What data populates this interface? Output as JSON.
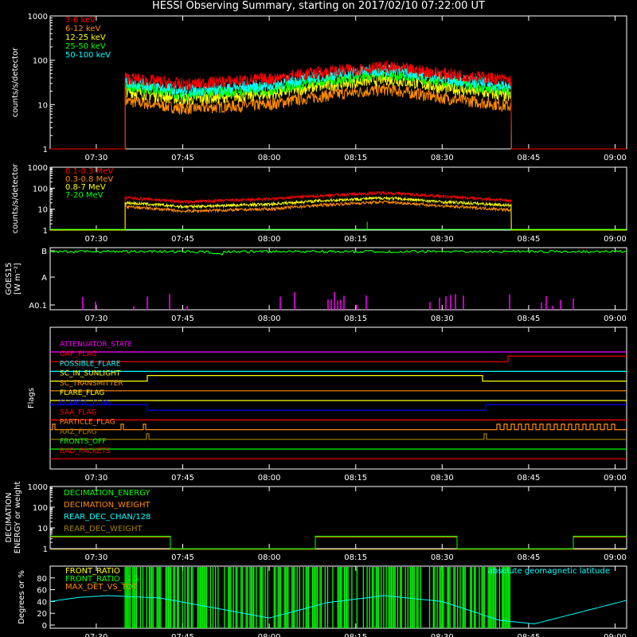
{
  "title": "HESSI Observing Summary, starting on 2017/02/10 07:22:00 UT",
  "colors": {
    "background": "#000000",
    "axes": "#ffffff",
    "red": "#ff0000",
    "orange": "#ff8c00",
    "yellow": "#ffff00",
    "green": "#00ff00",
    "cyan": "#00ffff",
    "magenta": "#ff00ff",
    "blue": "#0000ff",
    "brown": "#a08000"
  },
  "time_ticks": [
    "07:30",
    "07:45",
    "08:00",
    "08:15",
    "08:30",
    "08:45",
    "09:00"
  ],
  "chart_data": [
    {
      "type": "line",
      "panel": "hxr",
      "ylabel": "counts/s/detector",
      "yscale": "log",
      "ylim": [
        1,
        1000
      ],
      "yticks": [
        "1",
        "10",
        "100",
        "1000"
      ],
      "xlim": [
        "07:22",
        "09:02"
      ],
      "data_window": [
        "07:35",
        "08:42"
      ],
      "series": [
        {
          "name": "3-6 keV",
          "color": "red",
          "x": [
            "07:35",
            "07:45",
            "08:00",
            "08:10",
            "08:20",
            "08:30",
            "08:42"
          ],
          "y": [
            40,
            28,
            38,
            55,
            70,
            50,
            35
          ]
        },
        {
          "name": "6-12 keV",
          "color": "orange",
          "x": [
            "07:35",
            "07:45",
            "08:00",
            "08:10",
            "08:20",
            "08:30",
            "08:42"
          ],
          "y": [
            12,
            8,
            10,
            16,
            22,
            14,
            9
          ]
        },
        {
          "name": "12-25 keV",
          "color": "yellow",
          "x": [
            "07:35",
            "07:45",
            "08:00",
            "08:10",
            "08:20",
            "08:30",
            "08:42"
          ],
          "y": [
            20,
            13,
            17,
            27,
            38,
            24,
            15
          ]
        },
        {
          "name": "25-50 keV",
          "color": "green",
          "x": [
            "07:35",
            "07:45",
            "08:00",
            "08:10",
            "08:20",
            "08:30",
            "08:42"
          ],
          "y": [
            27,
            17,
            22,
            35,
            50,
            32,
            20
          ]
        },
        {
          "name": "50-100 keV",
          "color": "cyan",
          "x": [
            "07:35",
            "07:45",
            "08:00",
            "08:10",
            "08:20",
            "08:30",
            "08:42"
          ],
          "y": [
            32,
            20,
            27,
            45,
            62,
            40,
            24
          ]
        }
      ]
    },
    {
      "type": "line",
      "panel": "gamma",
      "ylabel": "counts/s/detector",
      "yscale": "log",
      "ylim": [
        1,
        1000
      ],
      "yticks": [
        "1",
        "10",
        "100",
        "1000"
      ],
      "xlim": [
        "07:22",
        "09:02"
      ],
      "data_window": [
        "07:35",
        "08:42"
      ],
      "series": [
        {
          "name": "0.1-0.3 MeV",
          "color": "red",
          "x": [
            "07:35",
            "07:45",
            "08:00",
            "08:10",
            "08:20",
            "08:30",
            "08:42"
          ],
          "y": [
            35,
            22,
            30,
            45,
            60,
            40,
            25
          ]
        },
        {
          "name": "0.3-0.8 MeV",
          "color": "orange",
          "x": [
            "07:35",
            "07:45",
            "08:00",
            "08:10",
            "08:20",
            "08:30",
            "08:42"
          ],
          "y": [
            13,
            8,
            10,
            16,
            22,
            14,
            9
          ]
        },
        {
          "name": "0.8-7 MeV",
          "color": "yellow",
          "x": [
            "07:35",
            "07:45",
            "08:00",
            "08:10",
            "08:20",
            "08:30",
            "08:42"
          ],
          "y": [
            20,
            13,
            17,
            26,
            34,
            22,
            15
          ]
        },
        {
          "name": "7-20 MeV",
          "color": "green",
          "x": [
            "07:22",
            "09:02"
          ],
          "y": [
            1,
            1
          ]
        }
      ]
    },
    {
      "type": "line",
      "panel": "goes",
      "ylabel": "GOES15",
      "yunit": "[W m⁻²]",
      "yticks": [
        "A0.1",
        "A",
        "B"
      ],
      "xlim": [
        "07:22",
        "09:02"
      ],
      "series": [
        {
          "name": "GOES flux",
          "color": "green",
          "level": "B"
        }
      ],
      "spikes_color": "magenta"
    },
    {
      "type": "line",
      "panel": "flags",
      "ylabel": "Flags",
      "xlim": [
        "07:22",
        "09:02"
      ],
      "flags": [
        {
          "name": "ATTENUATOR_STATE",
          "color": "magenta"
        },
        {
          "name": "GAP_FLAG",
          "color": "red"
        },
        {
          "name": "POSSIBLE_FLARE",
          "color": "cyan"
        },
        {
          "name": "SC_IN_SUNLIGHT",
          "color": "yellow"
        },
        {
          "name": "SC_TRANSMITTER",
          "color": "orange"
        },
        {
          "name": "FLARE_FLAG",
          "color": "yellow"
        },
        {
          "name": "ECLIPSE_FLAG",
          "color": "blue"
        },
        {
          "name": "SAA_FLAG",
          "color": "red"
        },
        {
          "name": "PARTICLE_FLAG",
          "color": "orange"
        },
        {
          "name": "AAZ_FLAG",
          "color": "brown"
        },
        {
          "name": "FRONTS_OFF",
          "color": "green"
        },
        {
          "name": "BAD_PACKETS",
          "color": "red"
        }
      ]
    },
    {
      "type": "line",
      "panel": "decimation",
      "ylabel": "DECIMATION ENERGY or weight",
      "yscale": "log",
      "ylim": [
        1,
        1000
      ],
      "yticks": [
        "1",
        "10",
        "100",
        "1000"
      ],
      "xlim": [
        "07:22",
        "09:02"
      ],
      "series": [
        {
          "name": "DECIMATION_ENERGY",
          "color": "green"
        },
        {
          "name": "DECIMATION_WEIGHT",
          "color": "orange"
        },
        {
          "name": "REAR_DEC_CHAN/128",
          "color": "cyan"
        },
        {
          "name": "REAR_DEC_WEIGHT",
          "color": "brown"
        }
      ]
    },
    {
      "type": "line",
      "panel": "ratio",
      "ylabel": "Degrees or %",
      "ylim": [
        0,
        100
      ],
      "yticks": [
        "0",
        "20",
        "40",
        "60",
        "80"
      ],
      "xlim": [
        "07:22",
        "09:02"
      ],
      "series": [
        {
          "name": "FRONT_RATIO",
          "color": "yellow"
        },
        {
          "name": "FRONT_RATIO_ 2.5",
          "color": "green"
        },
        {
          "name": "MAX_DET_VS_TOT",
          "color": "orange"
        },
        {
          "name": "absolute geomagnetic latitude",
          "color": "cyan",
          "x": [
            "07:22",
            "07:27",
            "07:32",
            "07:41",
            "07:50",
            "08:00",
            "08:10",
            "08:20",
            "08:30",
            "08:40",
            "08:46",
            "09:02"
          ],
          "y": [
            40,
            47,
            50,
            46,
            30,
            12,
            38,
            50,
            40,
            8,
            2,
            42
          ]
        }
      ]
    }
  ]
}
